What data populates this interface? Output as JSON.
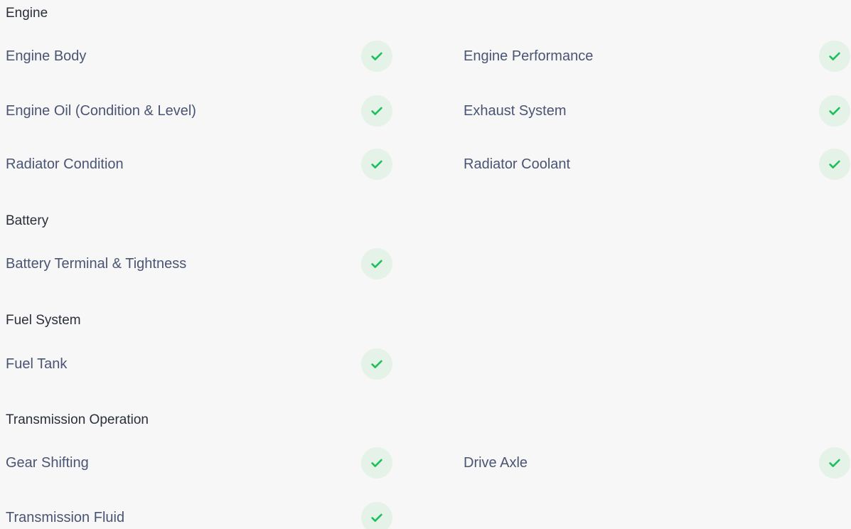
{
  "colors": {
    "check_bg": "#e4f2e7",
    "check_mark": "#1bbf5b",
    "label": "#4a5473",
    "title": "#2a2f3a",
    "background": "#f7f7f7"
  },
  "icons": {
    "check": "check-icon"
  },
  "sections": [
    {
      "title": "Engine",
      "rows": [
        {
          "left": "Engine Body",
          "right": "Engine Performance"
        },
        {
          "left": "Engine Oil (Condition & Level)",
          "right": "Exhaust System"
        },
        {
          "left": "Radiator Condition",
          "right": "Radiator Coolant"
        }
      ]
    },
    {
      "title": "Battery",
      "rows": [
        {
          "left": "Battery Terminal & Tightness"
        }
      ]
    },
    {
      "title": "Fuel System",
      "rows": [
        {
          "left": "Fuel Tank"
        }
      ]
    },
    {
      "title": "Transmission Operation",
      "rows": [
        {
          "left": "Gear Shifting",
          "right": "Drive Axle"
        },
        {
          "left": "Transmission Fluid"
        }
      ]
    }
  ]
}
